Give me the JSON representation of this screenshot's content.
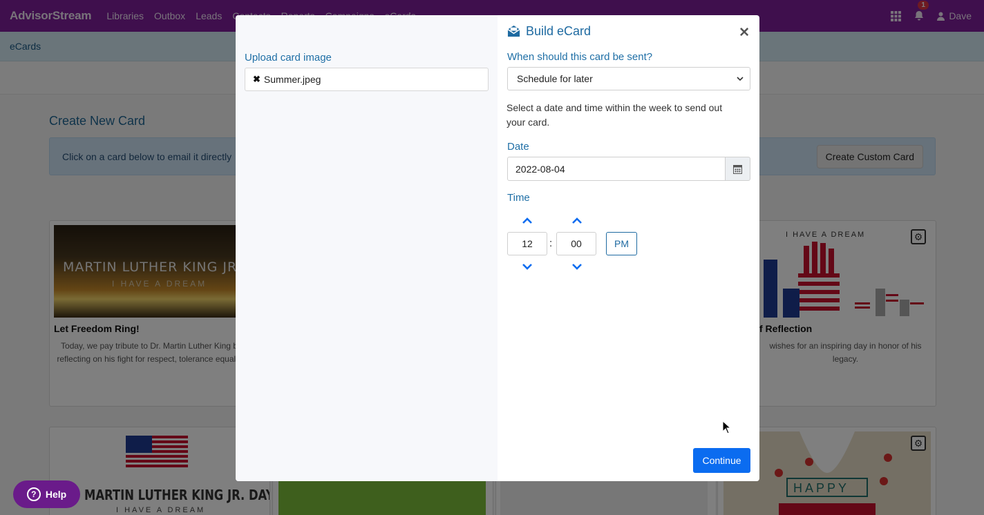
{
  "app": {
    "brand": "AdvisorStream",
    "nav": [
      "Libraries",
      "Outbox",
      "Leads",
      "Contacts",
      "Reports",
      "Campaigns",
      "eCards"
    ],
    "notification_count": "1",
    "user_name": "Dave",
    "icons": {
      "apps": "grid-icon",
      "notifications": "bell-icon",
      "user": "user-icon"
    },
    "accent_color": "#7e1f9b"
  },
  "breadcrumb": "eCards",
  "page": {
    "section_title": "Create New Card",
    "info_text": "Click on a card below to email it directly",
    "custom_card_label": "Create Custom Card",
    "cards_row1": [
      {
        "image_title": "MARTIN LUTHER KING JR. D",
        "image_subtitle": "I HAVE A DREAM",
        "title": "Let Freedom Ring!",
        "description": "Today, we pay tribute to Dr. Martin Luther King by reflecting on his fight for respect, tolerance equality."
      },
      {
        "image_title": "I HAVE A DREAM",
        "title": "f Reflection",
        "description": "wishes for an inspiring day in honor of his legacy."
      }
    ],
    "cards_row2": [
      {
        "image_title": "MARTIN LUTHER KING JR. DAY",
        "image_subtitle": "I HAVE A DREAM"
      },
      {
        "image_title": "HAPPY"
      }
    ]
  },
  "help_button": "Help",
  "modal": {
    "upload_label": "Upload card image",
    "file_name": "Summer.jpeg",
    "title": "Build eCard",
    "close_icon": "close-icon",
    "send_question": "When should this card be sent?",
    "send_option": "Schedule for later",
    "schedule_help": "Select a date and time within the week to send out your card.",
    "date_label": "Date",
    "date_value": "2022-08-04",
    "time_label": "Time",
    "hour": "12",
    "minute": "00",
    "period": "PM",
    "continue_label": "Continue",
    "primary_color": "#0b6cf0"
  }
}
